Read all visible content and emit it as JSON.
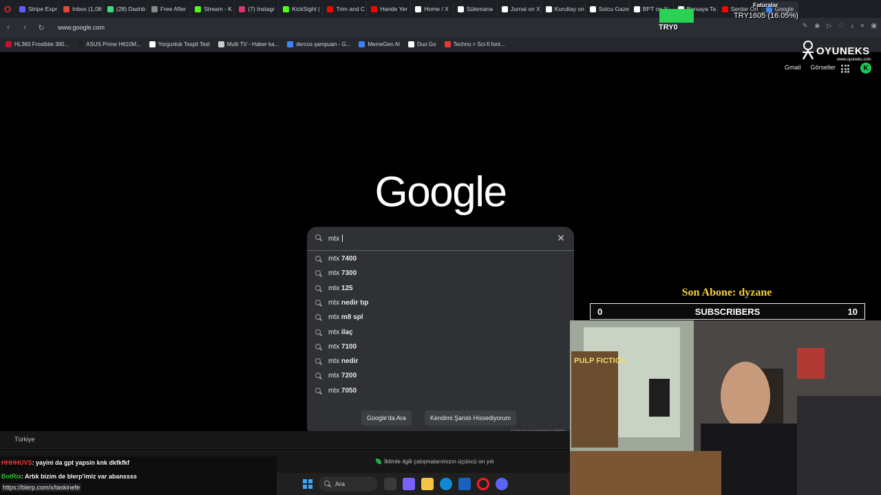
{
  "tabs": [
    {
      "label": "Stripe Expr",
      "color": "#635bff"
    },
    {
      "label": "Inbox (1,08",
      "color": "#ea4335"
    },
    {
      "label": "(28) Dashb",
      "color": "#3ddc84"
    },
    {
      "label": "Free After",
      "color": "#888888"
    },
    {
      "label": "Stream - K",
      "color": "#53fc18"
    },
    {
      "label": "(7) Instagr",
      "color": "#e1306c"
    },
    {
      "label": "KickSight |",
      "color": "#53fc18"
    },
    {
      "label": "Trim and C",
      "color": "#ff0000"
    },
    {
      "label": "Hande Yer",
      "color": "#ff0000"
    },
    {
      "label": "Home / X",
      "color": "#ffffff"
    },
    {
      "label": "Sülemana",
      "color": "#ffffff"
    },
    {
      "label": "Jurnal on X",
      "color": "#ffffff"
    },
    {
      "label": "Kurultay on",
      "color": "#ffffff"
    },
    {
      "label": "Solcu Gaze",
      "color": "#ffffff"
    },
    {
      "label": "BPT on X:",
      "color": "#ffffff"
    },
    {
      "label": "Borsaya Ta",
      "color": "#ffffff"
    },
    {
      "label": "Serdar Ort",
      "color": "#ff0000"
    },
    {
      "label": "Google",
      "color": "#4285f4"
    }
  ],
  "nav": {
    "url": "www.google.com"
  },
  "bookmarks": [
    {
      "label": "HL360 Frostbite 360...",
      "color": "#c8102e"
    },
    {
      "label": "ASUS Prime H610M...",
      "color": "#222222"
    },
    {
      "label": "Yorgunluk Tespit Test",
      "color": "#ffffff"
    },
    {
      "label": "Multi TV - Haber ka...",
      "color": "#cccccc"
    },
    {
      "label": "dercos şampuan - G...",
      "color": "#4285f4"
    },
    {
      "label": "MemeGen AI",
      "color": "#3b82f6"
    },
    {
      "label": "Duo Go",
      "color": "#ffffff"
    },
    {
      "label": "Techno > Sci-fi font...",
      "color": "#e53935"
    }
  ],
  "header": {
    "gmail": "Gmail",
    "images": "Görseller",
    "avatar_letter": "K"
  },
  "logo": "Google",
  "search": {
    "query": "mtx ",
    "suggestions": [
      {
        "prefix": "mtx ",
        "suffix": "7400"
      },
      {
        "prefix": "mtx ",
        "suffix": "7300"
      },
      {
        "prefix": "mtx ",
        "suffix": "125"
      },
      {
        "prefix": "mtx ",
        "suffix": "nedir tıp"
      },
      {
        "prefix": "mtx ",
        "suffix": "m8 spl"
      },
      {
        "prefix": "mtx ",
        "suffix": "ilaç"
      },
      {
        "prefix": "mtx ",
        "suffix": "7100"
      },
      {
        "prefix": "mtx ",
        "suffix": "nedir"
      },
      {
        "prefix": "mtx ",
        "suffix": "7200"
      },
      {
        "prefix": "mtx ",
        "suffix": "7050"
      }
    ],
    "search_button": "Google'da Ara",
    "lucky_button": "Kendimi Şanslı Hissediyorum",
    "report_text": "Uygunsuz tahminleri bildirin"
  },
  "footer": {
    "country": "Türkiye",
    "eco_text": "İklimle ilgili çalışmalarımızın üçüncü on yılı"
  },
  "chat": {
    "line1_user": "HHHHUVS",
    "line1_text": ": yayini da gpt yapsin knk dkfkfkf",
    "line2_user": "BotRix",
    "line2_text": ": Artık bizim de blerp'imiz var abanssss",
    "url": "https://blerp.com/x/taskinefe"
  },
  "taskbar": {
    "search_label": "Ara"
  },
  "overlay": {
    "donation_text": "TRY1605 (16.05%)",
    "donation_sub": "TRY0",
    "donation_title": "Faturalar",
    "sponsor_name": "OYUNEKS",
    "sponsor_url": "www.oyuneks.com",
    "last_sub": "Son Abone: dyzane",
    "sub_current": "0",
    "sub_label": "SUBSCRIBERS",
    "sub_goal": "10",
    "donation_progress_pct": 16.05
  },
  "colors": {
    "accent_green": "#2bd152",
    "sub_gold": "#f4d03f",
    "kick_green": "#17c85b"
  }
}
